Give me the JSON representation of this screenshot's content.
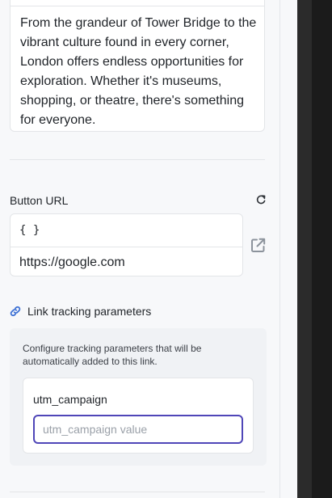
{
  "description": {
    "text": "From the grandeur of Tower Bridge to the vibrant culture found in every corner, London offers endless opportunities for exploration. Whether it's museums, shopping, or theatre, there's something for everyone."
  },
  "button_url": {
    "label": "Button URL",
    "variable_placeholder": "{ }",
    "value": "https://google.com",
    "refresh_icon": "refresh-icon",
    "open_icon": "external-link-icon"
  },
  "tracking": {
    "toggle_label": "Link tracking parameters",
    "toggle_icon": "link-icon",
    "description": "Configure tracking parameters that will be automatically added to this link.",
    "params": [
      {
        "name": "utm_campaign",
        "placeholder": "utm_campaign value",
        "value": ""
      }
    ]
  },
  "colors": {
    "accent": "#4f46b8",
    "link_icon": "#3b6fd4"
  }
}
